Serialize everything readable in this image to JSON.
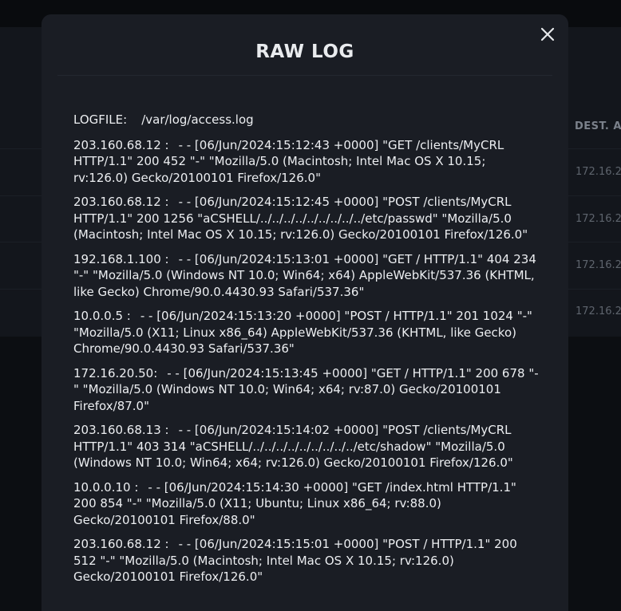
{
  "background": {
    "column_header": "DEST. A",
    "cells": [
      "172.16.2",
      "172.16.2",
      "172.16.2",
      "172.16.2"
    ]
  },
  "modal": {
    "title": "RAW LOG",
    "logfile_label": "LOGFILE:",
    "logfile_path": "/var/log/access.log",
    "entries": [
      {
        "ip": "203.160.68.12 :",
        "text": "- - [06/Jun/2024:15:12:43 +0000] \"GET /clients/MyCRL HTTP/1.1\" 200 452 \"-\" \"Mozilla/5.0 (Macintosh; Intel Mac OS X 10.15; rv:126.0) Gecko/20100101 Firefox/126.0\""
      },
      {
        "ip": "203.160.68.12 :",
        "text": "- - [06/Jun/2024:15:12:45 +0000] \"POST /clients/MyCRL HTTP/1.1\" 200 1256 \"aCSHELL/../../../../../../../../../etc/passwd\" \"Mozilla/5.0 (Macintosh; Intel Mac OS X 10.15; rv:126.0) Gecko/20100101 Firefox/126.0\""
      },
      {
        "ip": "192.168.1.100 :",
        "text": "- - [06/Jun/2024:15:13:01 +0000] \"GET / HTTP/1.1\" 404 234 \"-\" \"Mozilla/5.0 (Windows NT 10.0; Win64; x64) AppleWebKit/537.36 (KHTML, like Gecko) Chrome/90.0.4430.93 Safari/537.36\""
      },
      {
        "ip": "10.0.0.5 :",
        "text": "- - [06/Jun/2024:15:13:20 +0000] \"POST / HTTP/1.1\" 201 1024 \"-\" \"Mozilla/5.0 (X11; Linux x86_64) AppleWebKit/537.36 (KHTML, like Gecko) Chrome/90.0.4430.93 Safari/537.36\""
      },
      {
        "ip": "172.16.20.50:",
        "text": "- - [06/Jun/2024:15:13:45 +0000] \"GET / HTTP/1.1\" 200 678 \"-\" \"Mozilla/5.0 (Windows NT 10.0; Win64; x64; rv:87.0) Gecko/20100101 Firefox/87.0\""
      },
      {
        "ip": "203.160.68.13 :",
        "text": "- - [06/Jun/2024:15:14:02 +0000] \"POST /clients/MyCRL HTTP/1.1\" 403 314 \"aCSHELL/../../../../../../../../../etc/shadow\" \"Mozilla/5.0 (Windows NT 10.0; Win64; x64; rv:126.0) Gecko/20100101 Firefox/126.0\""
      },
      {
        "ip": "10.0.0.10 :",
        "text": "- - [06/Jun/2024:15:14:30 +0000] \"GET /index.html HTTP/1.1\" 200 854 \"-\" \"Mozilla/5.0 (X11; Ubuntu; Linux x86_64; rv:88.0) Gecko/20100101 Firefox/88.0\""
      },
      {
        "ip": "203.160.68.12 :",
        "text": "- - [06/Jun/2024:15:15:01 +0000] \"POST / HTTP/1.1\" 200 512 \"-\" \"Mozilla/5.0 (Macintosh; Intel Mac OS X 10.15; rv:126.0) Gecko/20100101 Firefox/126.0\""
      }
    ]
  }
}
